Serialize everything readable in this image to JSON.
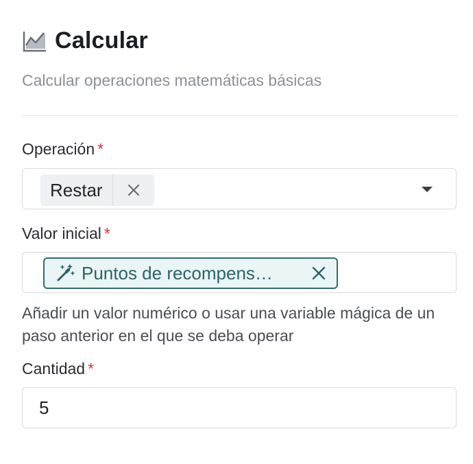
{
  "header": {
    "icon": "area-chart-icon",
    "title": "Calcular",
    "subtitle": "Calcular operaciones matemáticas básicas"
  },
  "fields": {
    "operation": {
      "label": "Operación",
      "required_mark": "*",
      "selected": "Restar",
      "remove_icon": "close-icon",
      "caret_icon": "caret-down-icon"
    },
    "initial_value": {
      "label": "Valor inicial",
      "required_mark": "*",
      "magic_variable": "Puntos de recompens…",
      "magic_icon": "magic-wand-icon",
      "remove_icon": "close-icon",
      "help": "Añadir un valor numérico o usar una variable mágica de un paso anterior en el que se deba operar"
    },
    "amount": {
      "label": "Cantidad",
      "required_mark": "*",
      "value": "5"
    }
  },
  "colors": {
    "required": "#d8323a",
    "magic_border": "#2f6e72",
    "magic_text": "#2a6468",
    "magic_bg": "#eaf5f5"
  }
}
